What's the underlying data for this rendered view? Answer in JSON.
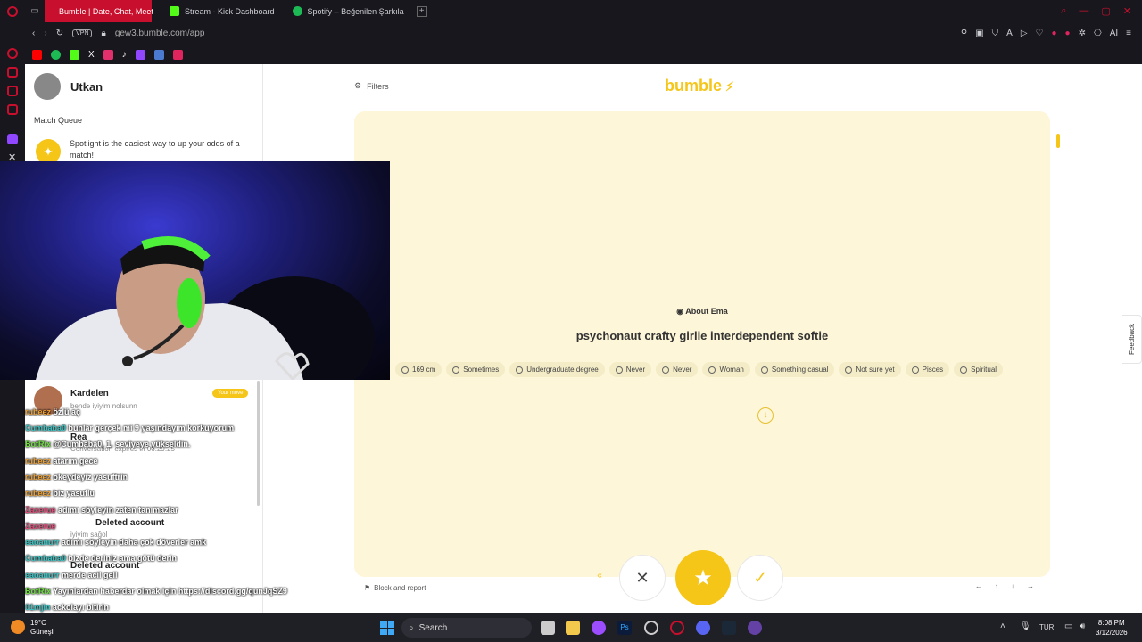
{
  "browser": {
    "tabs": [
      {
        "label": "Bumble | Date, Chat, Meet",
        "color": "#f5c518",
        "active": true
      },
      {
        "label": "Stream - Kick Dashboard",
        "color": "#53fc18",
        "active": false
      },
      {
        "label": "Spotify – Beğenilen Şarkıla",
        "color": "#1db954",
        "active": false
      }
    ],
    "vpn_label": "VPN",
    "url": "gew3.bumble.com/app",
    "ai_label": "AI"
  },
  "profile": {
    "name": "Utkan"
  },
  "match_queue": {
    "heading": "Match Queue",
    "spotlight_text": "Spotlight is the easiest way to up your odds of a match!"
  },
  "conversations": [
    {
      "name": "Kardelen",
      "snippet": "bende iyiyim nolsunn",
      "badge": "Your move"
    },
    {
      "name": "Rea",
      "snippet": "Conversation expires in 06:29:25"
    },
    {
      "name": "Deleted account",
      "snippet": "iyiyim sağol"
    },
    {
      "name": "Deleted account",
      "snippet": ""
    }
  ],
  "main": {
    "filters_label": "Filters",
    "logo": "bumble",
    "about_heading": "About Ema",
    "bio": "psychonaut crafty girlie interdependent softie",
    "chips": [
      "169 cm",
      "Sometimes",
      "Undergraduate degree",
      "Never",
      "Never",
      "Woman",
      "Something casual",
      "Not sure yet",
      "Pisces",
      "Spiritual"
    ],
    "block_report": "Block and report",
    "feedback": "Feedback"
  },
  "chat": [
    {
      "user": "rubeez",
      "msg": "özlü aç"
    },
    {
      "user": "Cumbaba0",
      "msg": "bunlar gerçek mi 9 yaşındayım korkuyorum"
    },
    {
      "user": "BotRix",
      "msg": "@Cumbaba0, 1. seviyeye yükseldin."
    },
    {
      "user": "rubeez",
      "msg": "atarım gece"
    },
    {
      "user": "rubeez",
      "msg": "okeydeyiz yasuftrin"
    },
    {
      "user": "rubeez",
      "msg": "biz yasuflu"
    },
    {
      "user": "Zaxerue",
      "msg": "adımı söyleyin zaten tanımazlar"
    },
    {
      "user": "Zaxerue",
      "msg": ""
    },
    {
      "user": "eaoanurr",
      "msg": "adımı söyleyin daha çok döverler amk"
    },
    {
      "user": "Cumbaba0",
      "msg": "bizde deriniz ama götü derin"
    },
    {
      "user": "eaoanurr",
      "msg": "merde acil gell"
    },
    {
      "user": "BotRix",
      "msg": "Yayınlardan haberdar olmak için https://discord.gg/qunJqSZ9"
    },
    {
      "user": "01mjin",
      "msg": "ackolayı bitirin"
    }
  ],
  "taskbar": {
    "temp": "19°C",
    "weather": "Güneşli",
    "search": "Search",
    "lang": "TUR",
    "time": "8:08 PM",
    "date": "3/12/2026"
  },
  "colors": {
    "bumble_yellow": "#f5c518",
    "card_bg": "#fdf6d8",
    "opera_red": "#c8102e"
  }
}
